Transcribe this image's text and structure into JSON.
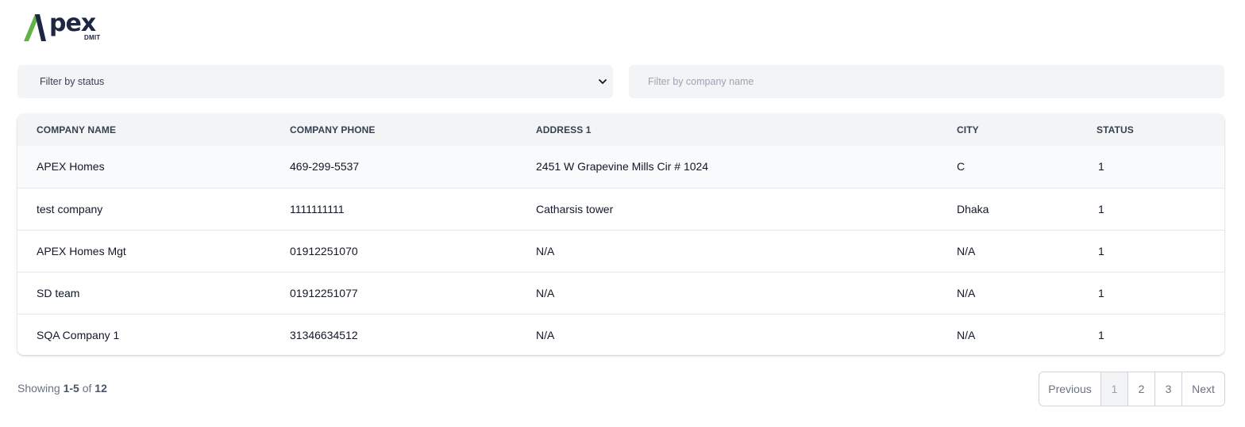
{
  "logo": {
    "word": "pex",
    "sub": "DMIT",
    "colors": {
      "green": "#5fb446",
      "navy": "#1d2642"
    }
  },
  "filters": {
    "status_label": "Filter by status",
    "company_placeholder": "Filter by company name"
  },
  "table": {
    "headers": [
      "COMPANY NAME",
      "COMPANY PHONE",
      "ADDRESS 1",
      "CITY",
      "STATUS"
    ],
    "rows": [
      {
        "name": "APEX Homes",
        "phone": "469-299-5537",
        "address": "2451 W Grapevine Mills Cir # 1024",
        "city": "C",
        "status": "1"
      },
      {
        "name": "test company",
        "phone": "1111111111",
        "address": "Catharsis tower",
        "city": "Dhaka",
        "status": "1"
      },
      {
        "name": "APEX Homes Mgt",
        "phone": "01912251070",
        "address": "N/A",
        "city": "N/A",
        "status": "1"
      },
      {
        "name": "SD team",
        "phone": "01912251077",
        "address": "N/A",
        "city": "N/A",
        "status": "1"
      },
      {
        "name": "SQA Company 1",
        "phone": "31346634512",
        "address": "N/A",
        "city": "N/A",
        "status": "1"
      }
    ]
  },
  "footer": {
    "showing_prefix": "Showing",
    "showing_range": "1-5",
    "showing_of": "of",
    "showing_total": "12"
  },
  "pagination": {
    "previous": "Previous",
    "pages": [
      "1",
      "2",
      "3"
    ],
    "next": "Next",
    "current": "1"
  }
}
